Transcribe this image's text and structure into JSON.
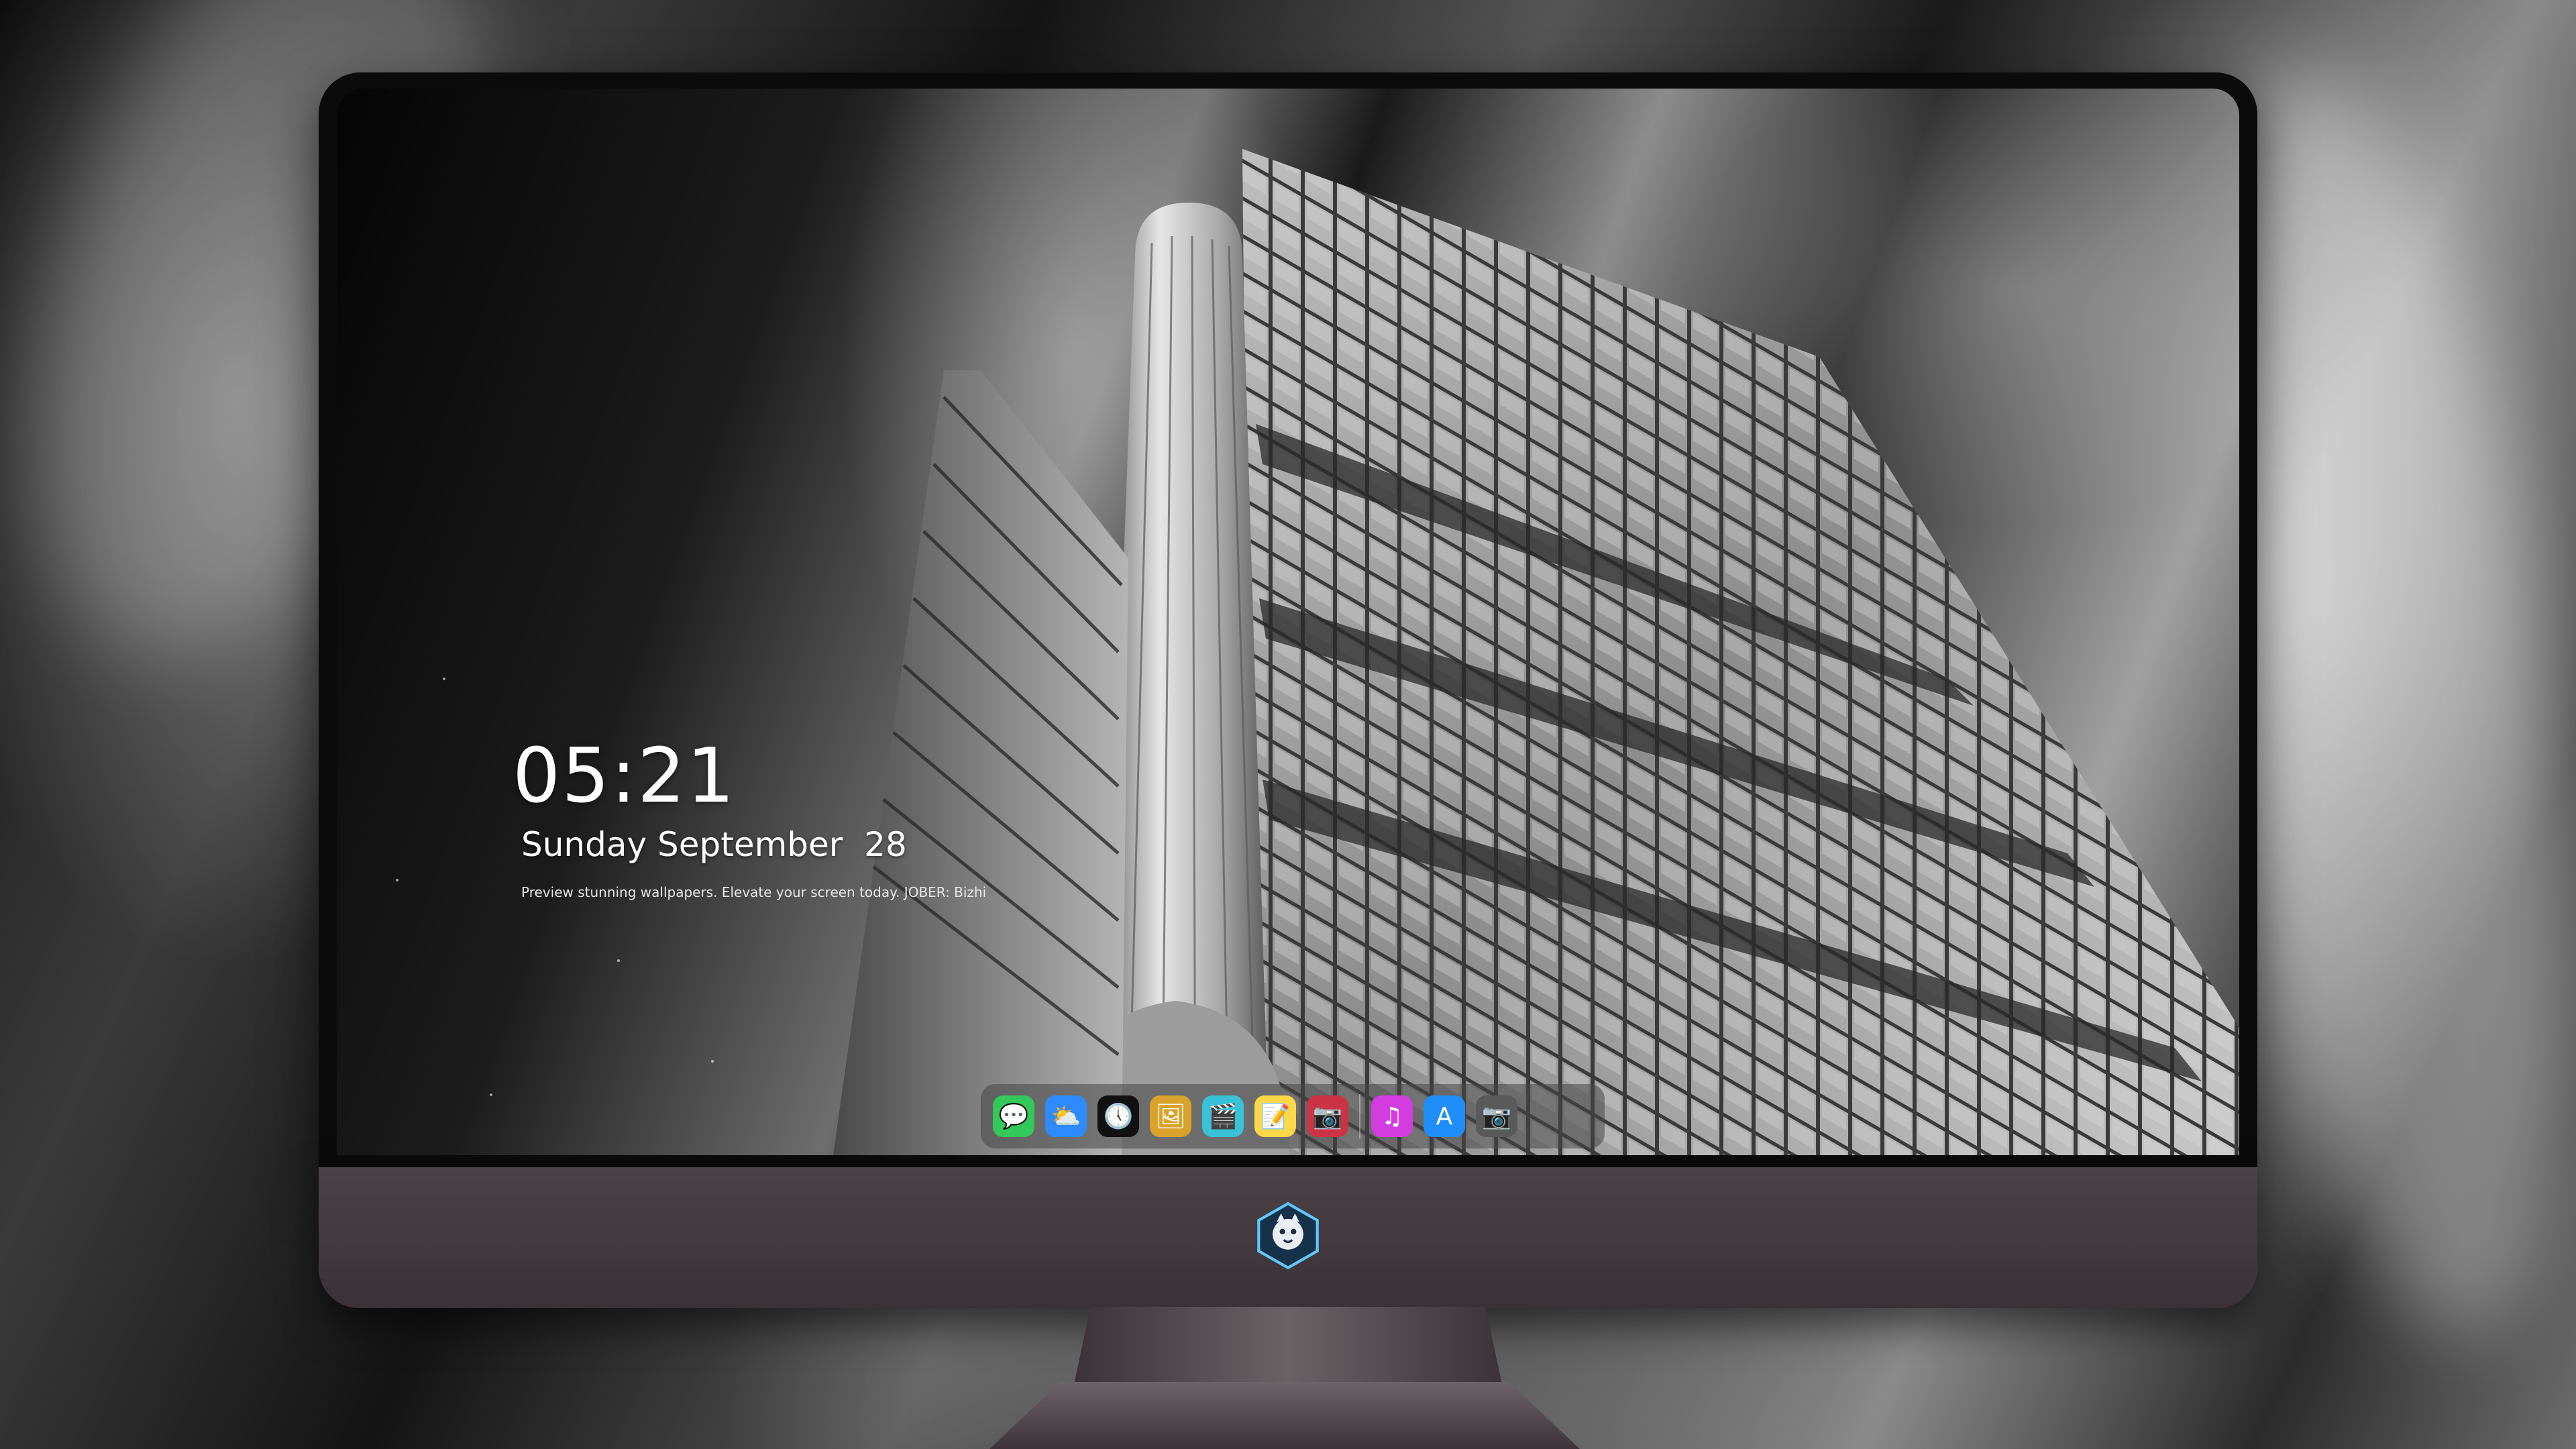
{
  "lockscreen": {
    "time": "05:21",
    "date": "Sunday September  28",
    "tagline": "Preview stunning wallpapers. Elevate your screen today. JOBER: Bizhi"
  },
  "dock": {
    "apps": [
      {
        "name": "messages",
        "glyph": "💬",
        "color": "#34c759"
      },
      {
        "name": "weather",
        "glyph": "⛅",
        "color": "#2e8bff"
      },
      {
        "name": "clock",
        "glyph": "🕔",
        "color": "#111111"
      },
      {
        "name": "preview",
        "glyph": "🖼",
        "color": "#d9a22a"
      },
      {
        "name": "final-cut",
        "glyph": "🎬",
        "color": "#39c2d7"
      },
      {
        "name": "notes",
        "glyph": "📝",
        "color": "#ffd84a"
      },
      {
        "name": "photo-booth",
        "glyph": "📷",
        "color": "#cc3344"
      }
    ],
    "apps_right": [
      {
        "name": "itunes",
        "glyph": "♫",
        "color": "#d33de0"
      },
      {
        "name": "app-store",
        "glyph": "A",
        "color": "#1f8efa"
      },
      {
        "name": "camera",
        "glyph": "📷",
        "color": "#5a5a5a"
      }
    ]
  },
  "brand": {
    "logo_icon": "tiger-mascot-icon"
  }
}
